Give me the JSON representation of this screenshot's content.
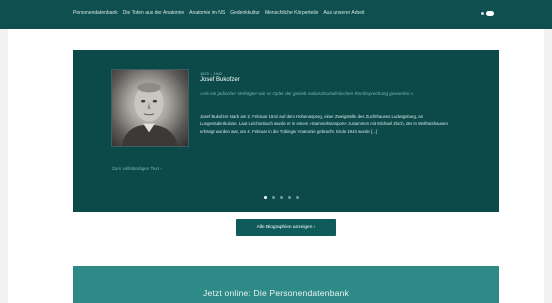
{
  "nav": {
    "items": [
      "Personendatenbank",
      "Die Toten aus der Anatomie",
      "Anatomie im NS",
      "Gedenkkultur",
      "Menschliche Körperteile",
      "Aus unserer Arbeit"
    ]
  },
  "slider": {
    "years": "1870 – 1942",
    "name": "Josef Bukofzer",
    "quote": "»Als ein jüdischer Verfolgter war er Opfer der gezielt nationalsozialistischen Rechtsprechung geworden.«",
    "bio": "Josef Bukofzer starb am 2. Februar 1942 auf dem Hohenasperg, einer Zweigstelle des Zuchthauses Ludwigsburg, an Lungentuberkulose. Laut Leichenbuch wurde er in einem »Sammeltransport« zusammen mit Michael Zloch, der in Wolfratshausen erhängt worden war, am 4. Februar in die Tübinger Anatomie gebracht. Ende 1943 wurde [...]",
    "read_more": "Zum vollständigen Text ›",
    "dot_count": 5,
    "active_dot": 0
  },
  "button": {
    "label": "Alle Biographien anzeigen ›"
  },
  "banner": {
    "title": "Jetzt online: Die Personendatenbank"
  },
  "colors": {
    "header": "#0f4f50",
    "slider": "#0c4a4a",
    "banner": "#2e8a86",
    "accent_text": "#7fb2ad"
  }
}
